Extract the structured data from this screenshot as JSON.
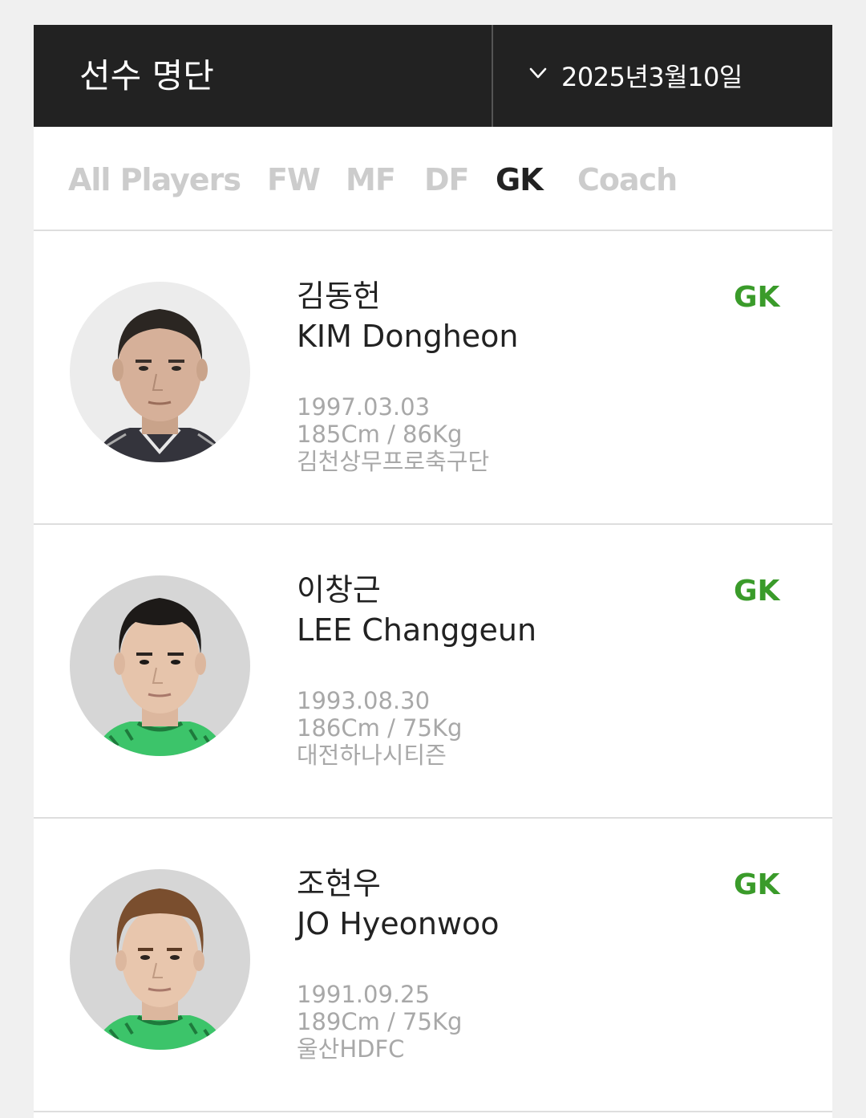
{
  "header": {
    "title": "선수 명단",
    "date": "2025년3월10일",
    "date_icon": "chevron-down-icon"
  },
  "tabs": [
    {
      "label": "All Players",
      "active": false
    },
    {
      "label": "FW",
      "active": false
    },
    {
      "label": "MF",
      "active": false
    },
    {
      "label": "DF",
      "active": false
    },
    {
      "label": "GK",
      "active": true
    },
    {
      "label": "Coach",
      "active": false
    }
  ],
  "players": [
    {
      "name_ko": "김동헌",
      "name_en": "KIM Dongheon",
      "position": "GK",
      "birth": "1997.03.03",
      "body": "185Cm / 86Kg",
      "club": "김천상무프로축구단"
    },
    {
      "name_ko": "이창근",
      "name_en": "LEE Changgeun",
      "position": "GK",
      "birth": "1993.08.30",
      "body": "186Cm / 75Kg",
      "club": "대전하나시티즌"
    },
    {
      "name_ko": "조현우",
      "name_en": "JO Hyeonwoo",
      "position": "GK",
      "birth": "1991.09.25",
      "body": "189Cm / 75Kg",
      "club": "울산HDFC"
    }
  ],
  "colors": {
    "header_bg": "#222222",
    "position_green": "#3a9b2a",
    "tab_inactive": "#cccccc",
    "tab_active": "#222222",
    "meta_gray": "#a8a8a8"
  }
}
